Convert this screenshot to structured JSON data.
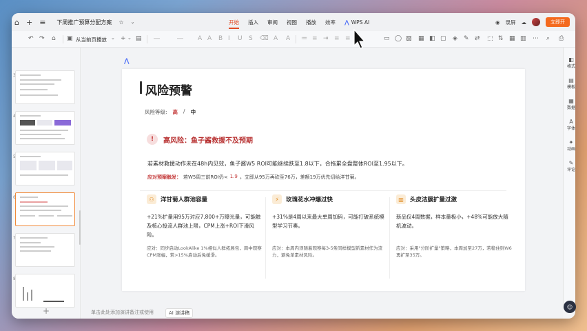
{
  "titlebar": {
    "doc_title": "下周推广预算分配方案",
    "tabs": [
      "开始",
      "插入",
      "审阅",
      "视图",
      "播放",
      "效率"
    ],
    "active_tab": "开始",
    "wps_ai": "WPS AI",
    "screenshot_label": "录屏",
    "vip_label": "立即开"
  },
  "toolbar": {
    "play_from_current": "从当前页播放"
  },
  "thumbnails": {
    "numbers": [
      "3",
      "4",
      "5",
      "6",
      "7",
      "8"
    ],
    "selected_index": 3
  },
  "slide": {
    "title": "风险预警",
    "level_label": "风险等级:",
    "level_high": "高",
    "level_sep": "/",
    "level_mid": "中",
    "alert_title": "高风险：鱼子酱救援不及预期",
    "alert_line1": "若素材救援动作未在48h内见效，鱼子酱W5 ROI可能继续跌至1.8以下，合拖累全盘整体ROI至1.95以下。",
    "trigger_label": "应对预案触发：",
    "trigger_text_1": "若W5周三前ROI仍<",
    "trigger_value": "1.9",
    "trigger_text_2": "，立即从95万再砍至76万，差额19万优先切给洋甘菊。",
    "cards": [
      {
        "icon": "users",
        "title": "洋甘菊人群池容量",
        "body": "+21%扩量用95万对应7,800+万曝光量，可能触及核心投流人群池上限，CPM上涨+ROI下滑风险。",
        "note": "应对：同步启动LookAlike 1%相似人群拓展包，周中观察CPM涨幅，若>15%启动后免缓滑。"
      },
      {
        "icon": "bolt",
        "title": "玫瑰花水冲爆过快",
        "body": "+31%是4周以来最大单周加码，可能打破系统模型学习节奏。",
        "note": "应对：本周内须随着观察每3-5条同样模型新素材作为流力，避免单素材风险。"
      },
      {
        "icon": "chart",
        "title": "头皮洁膜扩量过激",
        "body": "新品仅4周数据，样本量极小，+48%可能放大随机波动。",
        "note": "应对：采用\"分阶扩量\"策略，本周加至27万，若稳住则W6再扩至35万。"
      }
    ]
  },
  "status": {
    "notes_hint": "单击此处添加演讲备注或使用",
    "ai_notes": "AI 演讲稿"
  },
  "rpanel": {
    "items": [
      "格式",
      "模板",
      "数据",
      "字体",
      "动画",
      "评论"
    ]
  }
}
